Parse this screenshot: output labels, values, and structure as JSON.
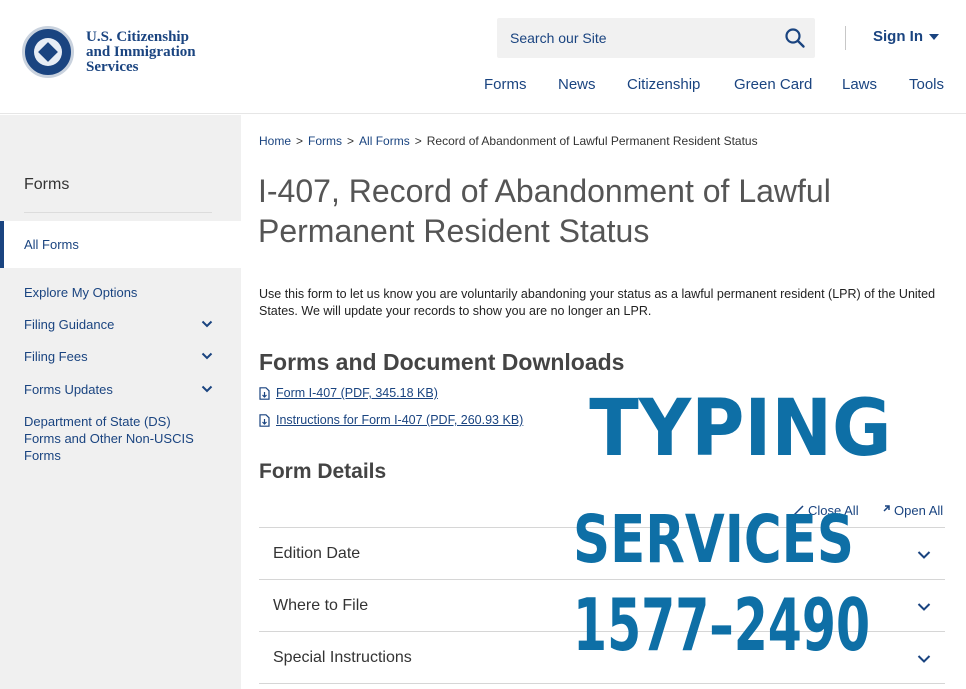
{
  "header": {
    "logo_line1": "U.S. Citizenship",
    "logo_line2": "and Immigration",
    "logo_line3": "Services",
    "search_placeholder": "Search our Site",
    "sign_in": "Sign In",
    "nav": [
      "Forms",
      "News",
      "Citizenship",
      "Green Card",
      "Laws",
      "Tools"
    ]
  },
  "sidebar": {
    "heading": "Forms",
    "active": "All Forms",
    "items": [
      {
        "label": "Explore My Options",
        "expandable": false
      },
      {
        "label": "Filing Guidance",
        "expandable": true
      },
      {
        "label": "Filing Fees",
        "expandable": true
      },
      {
        "label": "Forms Updates",
        "expandable": true
      },
      {
        "label": "Department of State (DS) Forms and Other Non-USCIS Forms",
        "expandable": false
      }
    ]
  },
  "breadcrumb": {
    "home": "Home",
    "forms": "Forms",
    "all_forms": "All Forms",
    "current": "Record of Abandonment of Lawful Permanent Resident Status",
    "separator": ">"
  },
  "main": {
    "title": "I-407, Record of Abandonment of Lawful Permanent Resident Status",
    "intro": "Use this form to let us know you are voluntarily abandoning your status as a lawful permanent resident (LPR) of the United States. We will update your records to show you are no longer an LPR.",
    "downloads_heading": "Forms and Document Downloads",
    "downloads": [
      "Form I-407 (PDF, 345.18 KB)",
      "Instructions for Form I-407 (PDF, 260.93 KB)"
    ],
    "details_heading": "Form Details",
    "close_all": "Close All",
    "open_all": "Open All",
    "accordion": [
      "Edition Date",
      "Where to File",
      "Special Instructions"
    ]
  },
  "overlay": {
    "line1": "TYPING",
    "line2": "SERVICES",
    "line3": "1577–2490",
    "color": "#0e6fa6"
  },
  "colors": {
    "brand_blue": "#1a4480",
    "sidebar_bg": "#f0f0f0"
  }
}
